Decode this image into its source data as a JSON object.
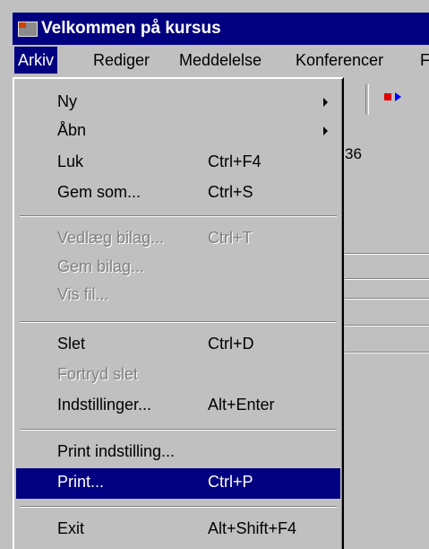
{
  "window": {
    "title": "Velkommen på kursus"
  },
  "menubar": {
    "items": [
      {
        "label": "Arkiv"
      },
      {
        "label": "Rediger"
      },
      {
        "label": "Meddelelse"
      },
      {
        "label": "Konferencer"
      },
      {
        "label": "F"
      }
    ]
  },
  "background": {
    "partial_number": "36"
  },
  "dropdown": {
    "ny": "Ny",
    "aabn": "Åbn",
    "luk": {
      "label": "Luk",
      "shortcut": "Ctrl+F4"
    },
    "gem_som": {
      "label": "Gem som...",
      "shortcut": "Ctrl+S"
    },
    "vedlaeg": {
      "label": "Vedlæg bilag...",
      "shortcut": "Ctrl+T"
    },
    "gem_bilag": "Gem bilag...",
    "vis_fil": "Vis fil...",
    "slet": {
      "label": "Slet",
      "shortcut": "Ctrl+D"
    },
    "fortryd": "Fortryd slet",
    "indstillinger": {
      "label": "Indstillinger...",
      "shortcut": "Alt+Enter"
    },
    "print_indstilling": "Print indstilling...",
    "print": {
      "label": "Print...",
      "shortcut": "Ctrl+P"
    },
    "exit": {
      "label": "Exit",
      "shortcut": "Alt+Shift+F4"
    }
  }
}
